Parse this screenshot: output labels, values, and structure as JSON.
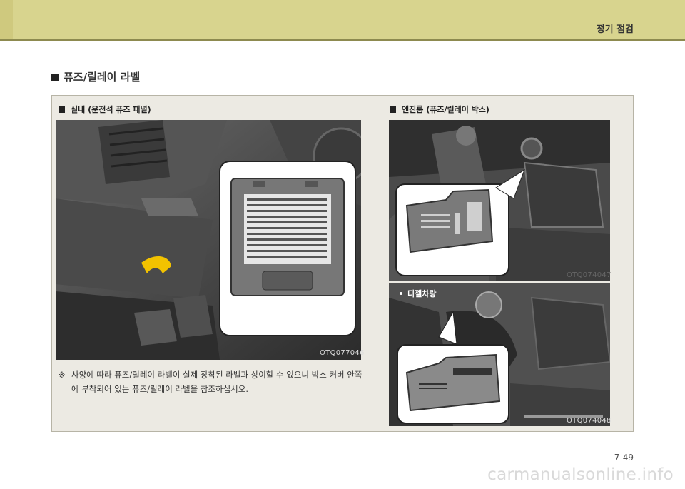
{
  "header": {
    "section_label": "정기 점검"
  },
  "heading": "퓨즈/릴레이 라벨",
  "left": {
    "title": "실내 (운전석 퓨즈 패널)",
    "photo_code": "OTQ077046",
    "note_mark": "※",
    "note_text": "사양에 따라 퓨즈/릴레이 라벨이 실제 장착된 라벨과 상이할 수 있으니 박스 커버 안쪽에 부착되어 있는 퓨즈/릴레이 라벨을 참조하십시오."
  },
  "right": {
    "title": "엔진룸 (퓨즈/릴레이 박스)",
    "photo1_code": "OTQ074047",
    "diesel_label": "디젤차량",
    "photo2_code": "OTQ074048"
  },
  "footer": {
    "page_number": "7-49",
    "watermark": "carmanualsonline.info"
  },
  "colors": {
    "topbar": "#d8d48e",
    "panel": "#eceae3",
    "accent_arrow": "#f2c200"
  }
}
